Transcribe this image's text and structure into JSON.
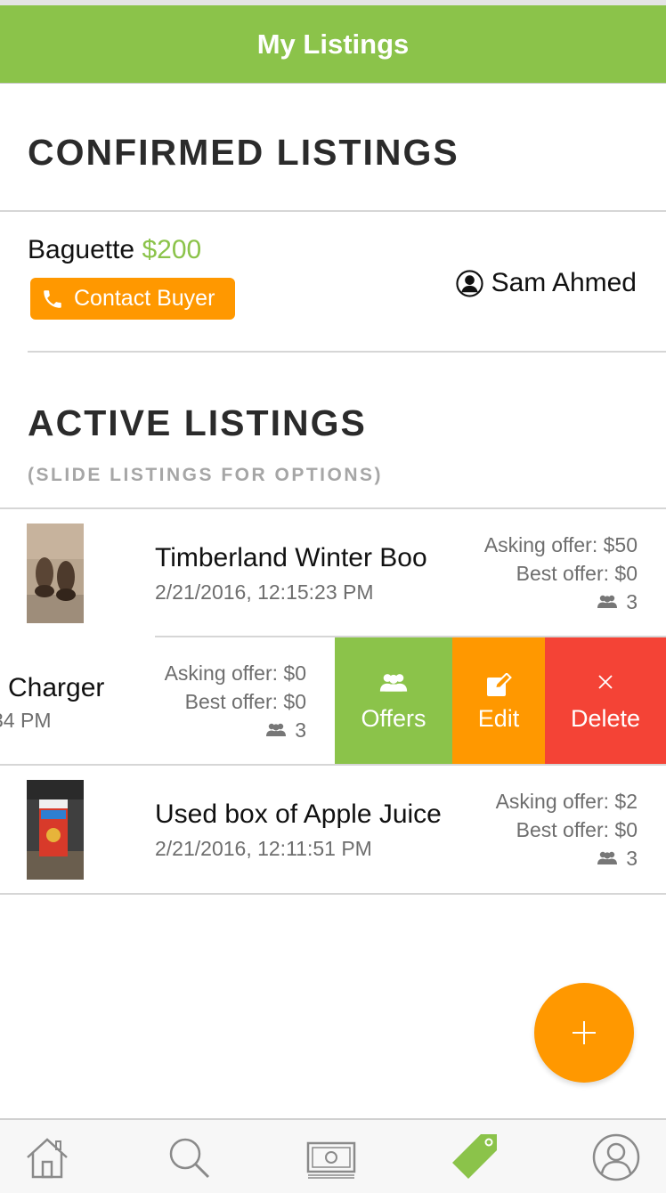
{
  "header": {
    "title": "My Listings"
  },
  "confirmed": {
    "heading": "CONFIRMED LISTINGS",
    "item": {
      "name": "Baguette",
      "price": "$200",
      "contact_label": "Contact Buyer",
      "buyer_name": "Sam Ahmed"
    }
  },
  "active": {
    "heading": "ACTIVE LISTINGS",
    "subheading": "(SLIDE LISTINGS FOR OPTIONS)",
    "items": [
      {
        "title": "Timberland Winter Boo",
        "date": "2/21/2016, 12:15:23 PM",
        "asking": "Asking offer: $50",
        "best": "Best offer: $0",
        "offers_count": "3"
      },
      {
        "title": "Charger",
        "date": "34 PM",
        "asking": "Asking offer: $0",
        "best": "Best offer: $0",
        "offers_count": "3",
        "actions": {
          "offers": "Offers",
          "edit": "Edit",
          "delete": "Delete"
        }
      },
      {
        "title": "Used box of Apple Juice",
        "date": "2/21/2016, 12:11:51 PM",
        "asking": "Asking offer: $2",
        "best": "Best offer: $0",
        "offers_count": "3"
      }
    ]
  },
  "colors": {
    "accent_green": "#8bc34a",
    "accent_orange": "#ff9800",
    "delete_red": "#f44336"
  },
  "icons": {
    "tabs": [
      "home-icon",
      "search-icon",
      "money-icon",
      "tag-icon",
      "profile-icon"
    ],
    "active_tab": "tag-icon"
  }
}
